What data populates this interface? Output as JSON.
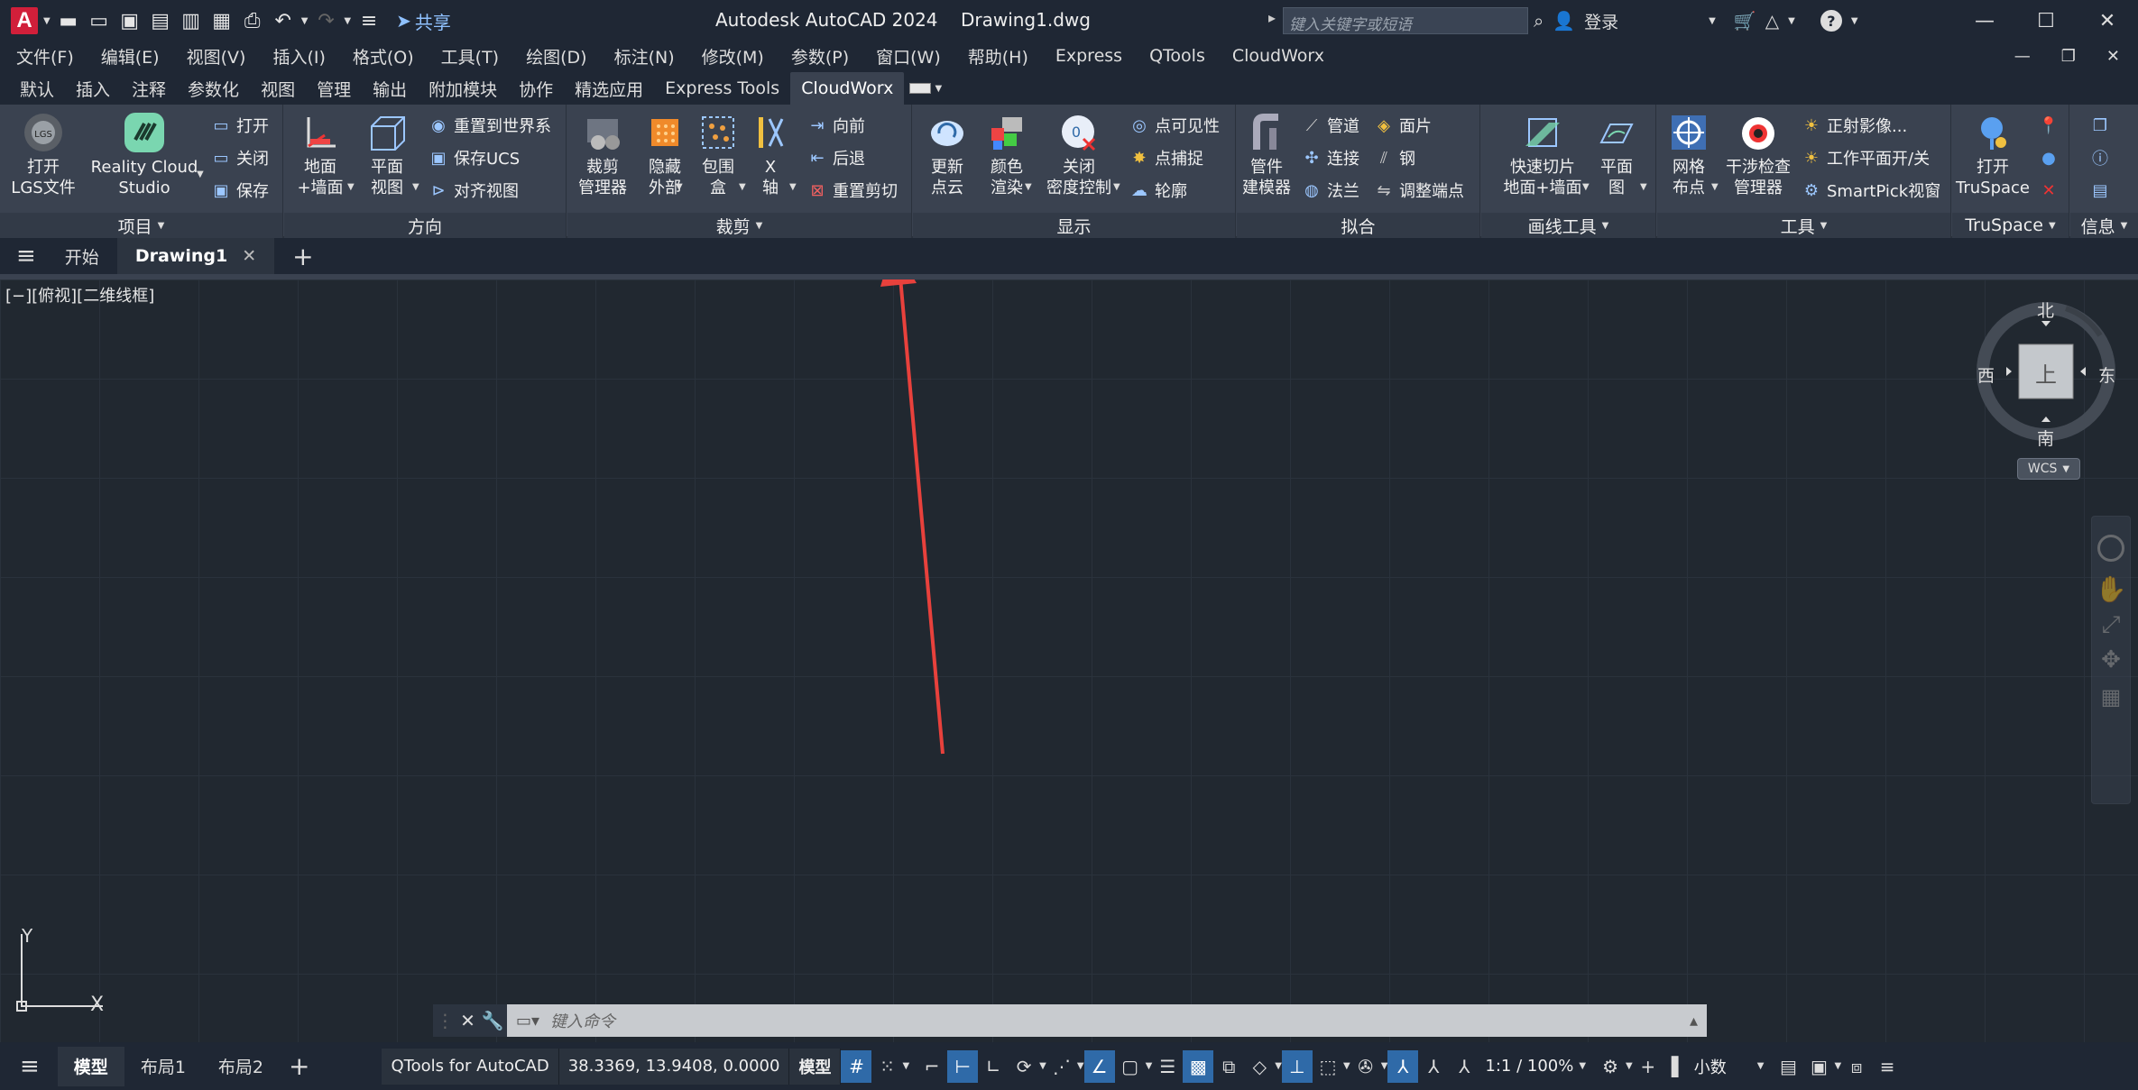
{
  "titlebar": {
    "app_letter": "A",
    "share": "共享",
    "title": "Autodesk AutoCAD 2024    Drawing1.dwg",
    "search_placeholder": "键入关键字或短语",
    "login": "登录"
  },
  "menubar": {
    "items": [
      "文件(F)",
      "编辑(E)",
      "视图(V)",
      "插入(I)",
      "格式(O)",
      "工具(T)",
      "绘图(D)",
      "标注(N)",
      "修改(M)",
      "参数(P)",
      "窗口(W)",
      "帮助(H)",
      "Express",
      "QTools",
      "CloudWorx"
    ]
  },
  "ribbon_tabs": {
    "items": [
      "默认",
      "插入",
      "注释",
      "参数化",
      "视图",
      "管理",
      "输出",
      "附加模块",
      "协作",
      "精选应用",
      "Express Tools",
      "CloudWorx"
    ],
    "active": "CloudWorx"
  },
  "ribbon": {
    "project": {
      "title": "项目",
      "open_lgs": [
        "打开",
        "LGS文件"
      ],
      "reality": [
        "Reality Cloud",
        "Studio"
      ],
      "open": "打开",
      "close": "关闭",
      "save": "保存"
    },
    "direction": {
      "title": "方向",
      "ground": [
        "地面",
        "+墙面"
      ],
      "plan": [
        "平面",
        "视图"
      ],
      "reset_world": "重置到世界系",
      "save_ucs": "保存UCS",
      "align_view": "对齐视图"
    },
    "clip": {
      "title": "裁剪",
      "clip_mgr": [
        "裁剪",
        "管理器"
      ],
      "hide_outer": [
        "隐藏",
        "外部"
      ],
      "box": [
        "包围",
        "盒"
      ],
      "xaxis": [
        "X",
        "轴"
      ],
      "forward": "向前",
      "back": "后退",
      "reset_clip": "重置剪切"
    },
    "display": {
      "title": "显示",
      "update": [
        "更新",
        "点云"
      ],
      "color": [
        "颜色",
        "渲染"
      ],
      "density": [
        "关闭",
        "密度控制"
      ],
      "visibility": "点可见性",
      "snap": "点捕捉",
      "outline": "轮廓"
    },
    "fit": {
      "title": "拟合",
      "pipe_modeler": [
        "管件",
        "建模器"
      ],
      "pipe": "管道",
      "connect": "连接",
      "flange": "法兰",
      "face": "面片",
      "steel": "钢",
      "adjust": "调整端点"
    },
    "drawtools": {
      "title": "画线工具",
      "quickslice": [
        "快速切片",
        "地面+墙面"
      ],
      "plane": [
        "平面",
        "图"
      ]
    },
    "tools": {
      "title": "工具",
      "grid": [
        "网格",
        "布点"
      ],
      "interference": [
        "干涉检查",
        "管理器"
      ],
      "ortho": "正射影像...",
      "workplane": "工作平面开/关",
      "smartpick": "SmartPick视窗"
    },
    "truspace": {
      "title": "TruSpace",
      "open": [
        "打开",
        "TruSpace"
      ]
    },
    "info": {
      "title": "信息"
    }
  },
  "filetabs": {
    "start": "开始",
    "drawing": "Drawing1"
  },
  "drawing": {
    "view_label": "[−][俯视][二维线框]",
    "compass": {
      "north": "北",
      "south": "南",
      "east": "东",
      "west": "西",
      "top": "上"
    },
    "wcs": "WCS",
    "ucs_y": "Y",
    "ucs_x": "X"
  },
  "command": {
    "placeholder": "键入命令"
  },
  "statusbar": {
    "model_tab": "模型",
    "layout1": "布局1",
    "layout2": "布局2",
    "qtools": "QTools for AutoCAD",
    "coords": "38.3369, 13.9408, 0.0000",
    "model": "模型",
    "scale": "1:1 / 100%",
    "units": "小数"
  },
  "colors": {
    "accent": "#2f6aa8",
    "annotation_arrow": "#e8413c",
    "brand": "#d11f3a"
  }
}
